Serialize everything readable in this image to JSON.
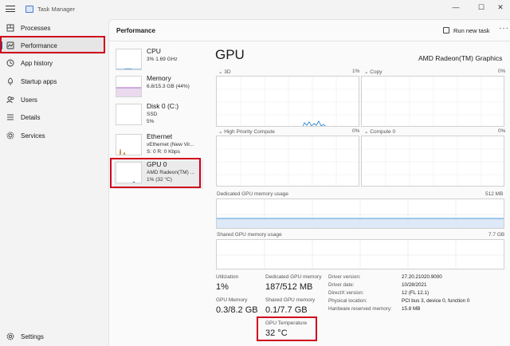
{
  "app": {
    "title": "Task Manager"
  },
  "window_controls": {
    "minimize": "—",
    "maximize": "☐",
    "close": "✕"
  },
  "sidebar": {
    "items": [
      {
        "label": "Processes",
        "icon": "processes-icon"
      },
      {
        "label": "Performance",
        "icon": "performance-icon",
        "active": true
      },
      {
        "label": "App history",
        "icon": "history-icon"
      },
      {
        "label": "Startup apps",
        "icon": "startup-icon"
      },
      {
        "label": "Users",
        "icon": "users-icon"
      },
      {
        "label": "Details",
        "icon": "details-icon"
      },
      {
        "label": "Services",
        "icon": "services-icon"
      }
    ],
    "settings_label": "Settings"
  },
  "header": {
    "title": "Performance",
    "run_new_task": "Run new task",
    "more": "···"
  },
  "devices": [
    {
      "name": "CPU",
      "sub1": "3% 1.69 GHz",
      "sub2": ""
    },
    {
      "name": "Memory",
      "sub1": "6.8/15.3 GB (44%)",
      "sub2": ""
    },
    {
      "name": "Disk 0 (C:)",
      "sub1": "SSD",
      "sub2": "5%"
    },
    {
      "name": "Ethernet",
      "sub1": "vEthernet (New Vir...",
      "sub2": "S: 0 R: 0 Kbps"
    },
    {
      "name": "GPU 0",
      "sub1": "AMD Radeon(TM) ...",
      "sub2": "1% (32 °C)",
      "selected": true
    }
  ],
  "gpu": {
    "title": "GPU",
    "model": "AMD Radeon(TM) Graphics",
    "engines": [
      {
        "name": "3D",
        "pct": "1%"
      },
      {
        "name": "Copy",
        "pct": "0%"
      },
      {
        "name": "High Priority Compute",
        "pct": "0%"
      },
      {
        "name": "Compute 0",
        "pct": "0%"
      }
    ],
    "dedicated_label": "Dedicated GPU memory usage",
    "dedicated_max": "512 MB",
    "shared_label": "Shared GPU memory usage",
    "shared_max": "7.7 GB",
    "stats": {
      "utilization_label": "Utilization",
      "utilization_value": "1%",
      "dedicated_label": "Dedicated GPU memory",
      "dedicated_value": "187/512 MB",
      "gpu_memory_label": "GPU Memory",
      "gpu_memory_value": "0.3/8.2 GB",
      "shared_label": "Shared GPU memory",
      "shared_value": "0.1/7.7 GB",
      "temp_label": "GPU Temperature",
      "temp_value": "32 °C"
    },
    "details": [
      {
        "key": "Driver version:",
        "value": "27.20.21020.9000"
      },
      {
        "key": "Driver date:",
        "value": "10/28/2021"
      },
      {
        "key": "DirectX version:",
        "value": "12 (FL 12.1)"
      },
      {
        "key": "Physical location:",
        "value": "PCI bus 3, device 0, function 0"
      },
      {
        "key": "Hardware reserved memory:",
        "value": "15.8 MB"
      }
    ]
  }
}
